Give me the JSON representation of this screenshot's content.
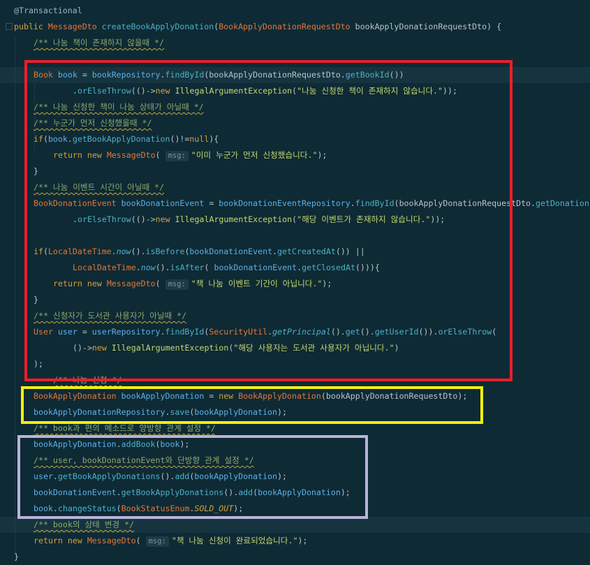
{
  "code": {
    "annotation": "@Transactional",
    "method_signature": {
      "modifier": "public",
      "return_type": "MessageDto",
      "name": "createBookApplyDonation",
      "param_type": "BookApplyDonationRequestDto",
      "param_name": "bookApplyDonationRequestDto",
      "tail": ") {"
    },
    "comments": {
      "c1": "/** 나눔 책이 존재하지 않을때 */",
      "c2": "/** 나눔 신청한 책이 나눔 상태가 아닐때 */",
      "c3": "/** 누군가 먼저 신청했을때 */",
      "c4": "/** 나눔 이벤트 시간이 아닐때 */",
      "c5": "/** 신청자가 도서관 사용자가 아닐때 */",
      "c6": "/** 나눔 신청 */",
      "c7": "/** book과 편의 메소드로 양방향 관계 설정 */",
      "c8": "/** user, bookDonationEvent와 단방향 관계 설정 */",
      "c9": "/** book의 상태 변경 */"
    },
    "strings": {
      "s1": "\"나눔 신청한 책이 존재하지 않습니다.\"",
      "s2": "\"이미 누군가 먼저 신청했습니다.\"",
      "s3": "\"해당 이벤트가 존재하지 않습니다.\"",
      "s4": "\"책 나눔 이벤트 기간이 아닙니다.\"",
      "s5": "\"해당 사용자는 도서관 사용자가 아닙니다.\"",
      "s6": "\"책 나눔 신청이 완료되었습니다.\""
    },
    "param_hint": "msg:",
    "identifiers": {
      "Book": "Book",
      "book": "book",
      "bookRepository": "bookRepository",
      "findById": "findById",
      "reqDto": "bookApplyDonationRequestDto",
      "getBookId": "getBookId",
      "orElseThrow": "orElseThrow",
      "new": "new",
      "IAE": "IllegalArgumentException",
      "if": "if",
      "return": "return",
      "MessageDto": "MessageDto",
      "getBookApplyDonation": "getBookApplyDonation",
      "null": "null",
      "BookDonationEvent": "BookDonationEvent",
      "bookDonationEvent": "bookDonationEvent",
      "bdeRepo": "bookDonationEventRepository",
      "getDonationTrunc": "getDonation",
      "LocalDateTime": "LocalDateTime",
      "now": "now",
      "isBefore": "isBefore",
      "isAfter": "isAfter",
      "getCreatedAt": "getCreatedAt",
      "getClosedAt": "getClosedAt",
      "User": "User",
      "user": "user",
      "userRepository": "userRepository",
      "SecurityUtil": "SecurityUtil",
      "getPrincipal": "getPrincipal",
      "get": "get",
      "getUserId": "getUserId",
      "BookApplyDonation": "BookApplyDonation",
      "bookApplyDonation": "bookApplyDonation",
      "badRepo": "bookApplyDonationRepository",
      "save": "save",
      "addBook": "addBook",
      "getBookApplyDonations": "getBookApplyDonations",
      "add": "add",
      "changeStatus": "changeStatus",
      "BookStatusEnum": "BookStatusEnum",
      "SOLD_OUT": "SOLD_OUT"
    },
    "closing_brace": "}"
  },
  "highlight_colors": {
    "red_box": "#e8202a",
    "yellow_box": "#f2ee10",
    "purple_box": "#b8b4da",
    "background": "#0e2a35"
  }
}
